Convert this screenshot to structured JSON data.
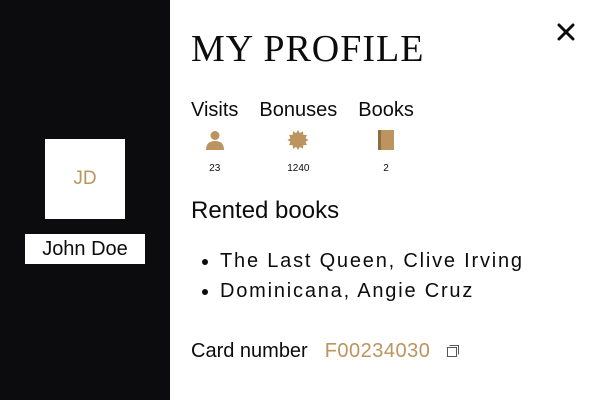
{
  "user": {
    "initials": "JD",
    "name": "John Doe"
  },
  "profile": {
    "title": "MY PROFILE",
    "close_icon": "close-icon"
  },
  "stats": [
    {
      "label": "Visits",
      "value": "23",
      "icon": "person-icon"
    },
    {
      "label": "Bonuses",
      "value": "1240",
      "icon": "badge-icon"
    },
    {
      "label": "Books",
      "value": "2",
      "icon": "book-icon"
    }
  ],
  "rented": {
    "title": "Rented books",
    "items": [
      "The Last Queen, Clive Irving",
      "Dominicana, Angie Cruz"
    ]
  },
  "card": {
    "label": "Card number",
    "value": "F00234030",
    "copy_icon": "copy-icon"
  },
  "colors": {
    "dark": "#0c0c0e",
    "accent": "#bb945f",
    "background": "#ffffff"
  }
}
